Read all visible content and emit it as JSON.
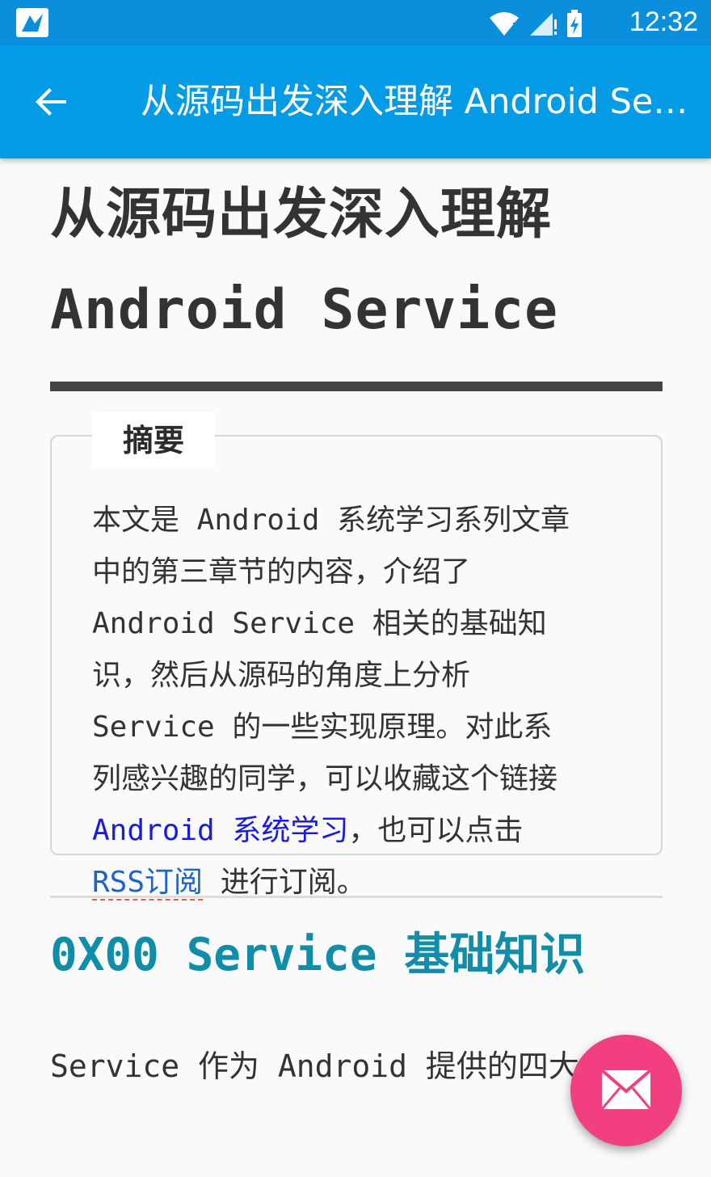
{
  "status_bar": {
    "time": "12:32",
    "icons": [
      "app-notification-icon",
      "wifi-icon",
      "signal-icon",
      "battery-charging-icon"
    ]
  },
  "toolbar": {
    "title": "从源码出发深入理解 Android Service",
    "back_icon": "arrow-back-icon"
  },
  "article": {
    "title_line1": "从源码出发深入理解",
    "title_line2": "Android Service",
    "summary": {
      "legend": "摘要",
      "lines": [
        "本文是 Android 系统学习系列文章",
        "中的第三章节的内容，介绍了",
        "Android Service 相关的基础知",
        "识，然后从源码的角度上分析",
        "Service 的一些实现原理。对此系",
        "列感兴趣的同学，可以收藏这个链接"
      ],
      "link_text": "Android 系统学习",
      "after_link": "，也可以点击",
      "rss_link": "RSS订阅",
      "end_text": " 进行订阅。"
    },
    "section_heading": "0X00 Service 基础知识",
    "body_start": "Service 作为 Android 提供的四大组件"
  },
  "fab": {
    "icon": "mail-icon"
  },
  "colors": {
    "status_bar": "#0a8fdc",
    "toolbar": "#039be5",
    "heading": "#108da8",
    "fab": "#f23f7f"
  }
}
